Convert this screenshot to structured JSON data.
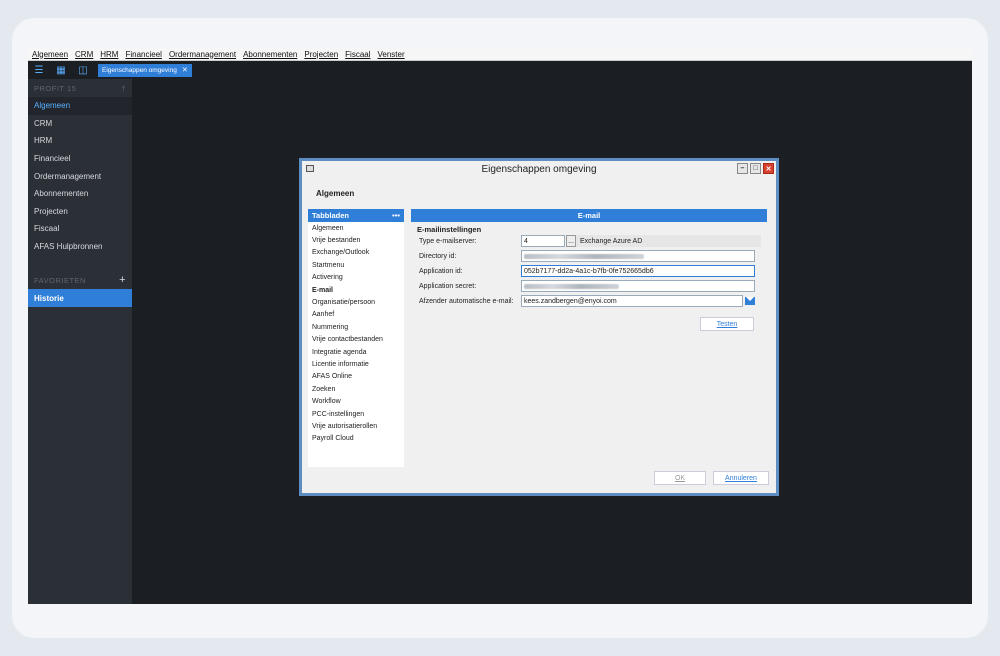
{
  "menubar": [
    "Algemeen",
    "CRM",
    "HRM",
    "Financieel",
    "Ordermanagement",
    "Abonnementen",
    "Projecten",
    "Fiscaal",
    "Venster"
  ],
  "toolbar": {
    "tab_label": "Eigenschappen omgeving",
    "icons": [
      "hamburger-icon",
      "grid-icon",
      "calendar-icon",
      "close-icon"
    ]
  },
  "sidebar": {
    "header": "PROFIT 15",
    "items": [
      "Algemeen",
      "CRM",
      "HRM",
      "Financieel",
      "Ordermanagement",
      "Abonnementen",
      "Projecten",
      "Fiscaal",
      "AFAS Hulpbronnen"
    ],
    "favorites_header": "FAVORIETEN",
    "favorites": [
      "Historie"
    ]
  },
  "dialog": {
    "title": "Eigenschappen omgeving",
    "heading": "Algemeen",
    "tabs_header": "Tabbladen",
    "tabs_more": "•••",
    "tabs": [
      "Algemeen",
      "Vrije bestanden",
      "Exchange/Outlook",
      "Startmenu",
      "Activering",
      "E-mail",
      "Organisatie/persoon",
      "Aanhef",
      "Nummering",
      "Vrije contactbestanden",
      "Integratie agenda",
      "Licentie informatie",
      "AFAS Online",
      "Zoeken",
      "Workflow",
      "PCC-instellingen",
      "Vrije autorisatierollen",
      "Payroll Cloud"
    ],
    "selected_tab": "E-mail",
    "panel_header": "E-mail",
    "section": "E-mailinstellingen",
    "fields": {
      "type_label": "Type e-mailserver:",
      "type_value": "4",
      "type_lookup": "...",
      "type_desc": "Exchange Azure AD",
      "directory_label": "Directory id:",
      "application_label": "Application id:",
      "application_value": "052b7177-dd2a-4a1c-b7fb-0fe752665db6",
      "secret_label": "Application secret:",
      "sender_label": "Afzender automatische e-mail:",
      "sender_value": "kees.zandbergen@enyoi.com"
    },
    "buttons": {
      "test": "Testen",
      "ok": "OK",
      "cancel": "Annuleren"
    }
  },
  "colors": {
    "accent": "#2f7ed8",
    "background": "#1b1e23",
    "sidebar": "#2b2f36"
  }
}
